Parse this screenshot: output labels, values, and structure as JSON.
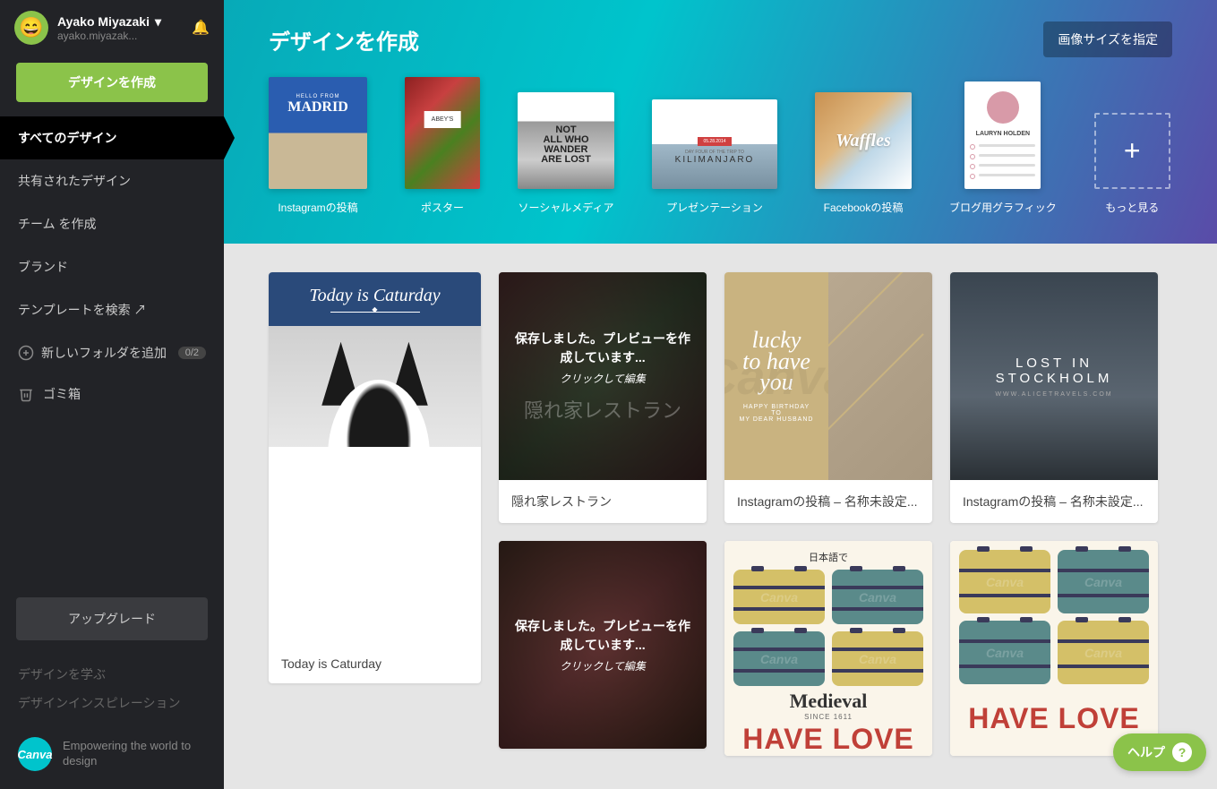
{
  "user": {
    "name": "Ayako Miyazaki",
    "email": "ayako.miyazak..."
  },
  "sidebar": {
    "create_button": "デザインを作成",
    "nav": [
      {
        "label": "すべてのデザイン",
        "active": true
      },
      {
        "label": "共有されたデザイン",
        "active": false
      },
      {
        "label": "チーム を作成",
        "active": false
      },
      {
        "label": "ブランド",
        "active": false
      },
      {
        "label": "テンプレートを検索 ↗",
        "active": false
      }
    ],
    "new_folder": "新しいフォルダを追加",
    "folder_count": "0/2",
    "trash": "ゴミ箱",
    "upgrade": "アップグレード",
    "footer_links": [
      "デザインを学ぶ",
      "デザインインスピレーション"
    ],
    "brand_logo": "Canva",
    "brand_tagline": "Empowering the world to design"
  },
  "hero": {
    "title": "デザインを作成",
    "size_button": "画像サイズを指定",
    "templates": [
      {
        "label": "Instagramの投稿",
        "thumb_title": "MADRID",
        "thumb_sub": "HELLO FROM"
      },
      {
        "label": "ポスター",
        "thumb_title": "ABEY'S"
      },
      {
        "label": "ソーシャルメディア",
        "thumb_title": "NOT\nALL WHO\nWANDER\nARE LOST"
      },
      {
        "label": "プレゼンテーション",
        "thumb_date": "05.28.2014",
        "thumb_sub": "DAY FOUR OF THE TRIP TO",
        "thumb_title": "KILIMANJARO"
      },
      {
        "label": "Facebookの投稿",
        "thumb_title": "Waffles"
      },
      {
        "label": "ブログ用グラフィック",
        "thumb_title": "LAURYN HOLDEN"
      }
    ],
    "more": "もっと見る"
  },
  "designs": {
    "overlay_saved": "保存しました。プレビューを作成しています...",
    "overlay_click": "クリックして編集",
    "cards": [
      {
        "title": "Today is Caturday",
        "header": "Today is Caturday"
      },
      {
        "title": "隠れ家レストラン",
        "blur_text": "隠れ家レストラン"
      },
      {
        "title": "Instagramの投稿 – 名称未設定...",
        "lucky": "lucky\nto have\nyou",
        "lucky_sub": "HAPPY BIRTHDAY TO\nMY DEAR HUSBAND"
      },
      {
        "title": "Instagramの投稿 – 名称未設定...",
        "stockholm": "LOST IN STOCKHOLM",
        "stockholm_sub": "WWW.ALICETRAVELS.COM"
      },
      {
        "japanese": "日本語で",
        "medieval": "Medieval",
        "since": "SINCE 1611",
        "havelove": "HAVE LOVE"
      },
      {
        "havelove": "HAVE LOVE"
      }
    ]
  },
  "help": "ヘルプ"
}
